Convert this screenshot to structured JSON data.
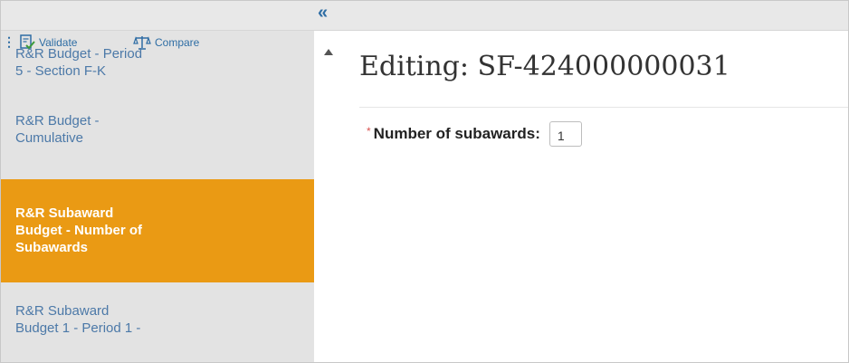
{
  "toolbar": {
    "validate_label": "Validate",
    "compare_label": "Compare",
    "collapse_glyph": "«",
    "icons": {
      "menu": "menu-icon",
      "validate": "validate-check-icon",
      "compare": "scales-compare-icon",
      "collapse": "double-chevron-left-icon",
      "scroll_up": "triangle-up-icon"
    }
  },
  "nav": {
    "items": [
      {
        "line1": "R&R Budget - Period",
        "line2": "5 - Section F-K",
        "line3": "",
        "active": false
      },
      {
        "line1": "R&R Budget -",
        "line2": "Cumulative",
        "line3": "",
        "active": false
      },
      {
        "line1": "R&R Subaward",
        "line2": "Budget - Number of",
        "line3": "Subawards",
        "active": true
      },
      {
        "line1": "R&R Subaward",
        "line2": "Budget 1 - Period 1 -",
        "line3": "",
        "active": false
      }
    ]
  },
  "main": {
    "title": "Editing: SF-424000000031",
    "required_marker": "*",
    "field_label": "Number of subawards:",
    "field_value": "1"
  },
  "colors": {
    "active_bg": "#ea9a14",
    "link": "#4c79a8",
    "sidebar_bg": "#e3e3e3",
    "required": "#d9534f"
  }
}
